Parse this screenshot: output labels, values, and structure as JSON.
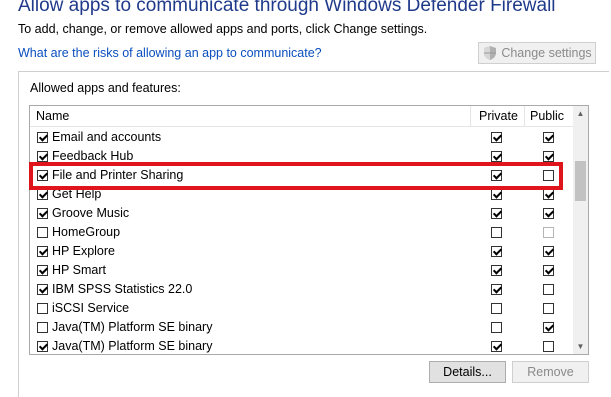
{
  "header": {
    "title": "Allow apps to communicate through Windows Defender Firewall",
    "subtitle": "To add, change, or remove allowed apps and ports, click Change settings.",
    "risk_link": "What are the risks of allowing an app to communicate?",
    "change_settings_label": "Change settings",
    "change_settings_icon": "uac-shield-icon"
  },
  "group": {
    "label": "Allowed apps and features:"
  },
  "table": {
    "columns": [
      "Name",
      "Private",
      "Public"
    ],
    "rows": [
      {
        "name": "Email and accounts",
        "enabled": true,
        "private": true,
        "public": true,
        "public_disabled": false
      },
      {
        "name": "Feedback Hub",
        "enabled": true,
        "private": true,
        "public": true,
        "public_disabled": false
      },
      {
        "name": "File and Printer Sharing",
        "enabled": true,
        "private": true,
        "public": false,
        "public_disabled": false
      },
      {
        "name": "Get Help",
        "enabled": true,
        "private": true,
        "public": true,
        "public_disabled": false
      },
      {
        "name": "Groove Music",
        "enabled": true,
        "private": true,
        "public": true,
        "public_disabled": false
      },
      {
        "name": "HomeGroup",
        "enabled": false,
        "private": false,
        "public": false,
        "public_disabled": true
      },
      {
        "name": "HP Explore",
        "enabled": true,
        "private": true,
        "public": true,
        "public_disabled": false
      },
      {
        "name": "HP Smart",
        "enabled": true,
        "private": true,
        "public": true,
        "public_disabled": false
      },
      {
        "name": "IBM SPSS Statistics 22.0",
        "enabled": true,
        "private": true,
        "public": false,
        "public_disabled": false
      },
      {
        "name": "iSCSI Service",
        "enabled": false,
        "private": false,
        "public": false,
        "public_disabled": false
      },
      {
        "name": "Java(TM) Platform SE binary",
        "enabled": false,
        "private": false,
        "public": true,
        "public_disabled": false
      },
      {
        "name": "Java(TM) Platform SE binary",
        "enabled": true,
        "private": true,
        "public": false,
        "public_disabled": false
      }
    ]
  },
  "buttons": {
    "details": "Details...",
    "remove": "Remove"
  },
  "highlight_color": "#e0141d"
}
